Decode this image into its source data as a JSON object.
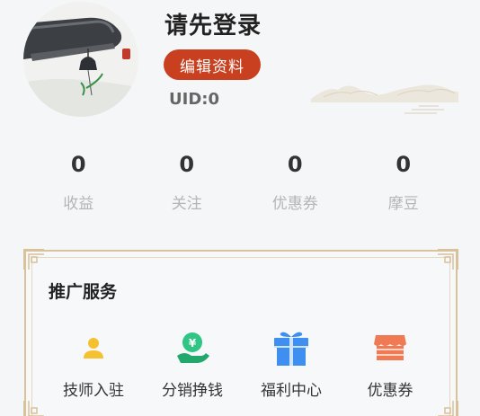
{
  "profile": {
    "username": "请先登录",
    "edit_label": "编辑资料",
    "uid": "UID:0"
  },
  "stats": [
    {
      "value": "0",
      "label": "收益"
    },
    {
      "value": "0",
      "label": "关注"
    },
    {
      "value": "0",
      "label": "优惠券"
    },
    {
      "value": "0",
      "label": "摩豆"
    }
  ],
  "promo": {
    "title": "推广服务",
    "services": [
      {
        "label": "技师入驻",
        "icon": "user-icon",
        "color": "#f6c12e"
      },
      {
        "label": "分销挣钱",
        "icon": "money-hand-icon",
        "color": "#2fc585"
      },
      {
        "label": "福利中心",
        "icon": "gift-icon",
        "color": "#3f8ff0"
      },
      {
        "label": "优惠券",
        "icon": "store-icon",
        "color": "#f07a53"
      }
    ]
  },
  "colors": {
    "accent": "#c8401f",
    "frame": "#d9c19a",
    "background": "#f5f6f8"
  }
}
